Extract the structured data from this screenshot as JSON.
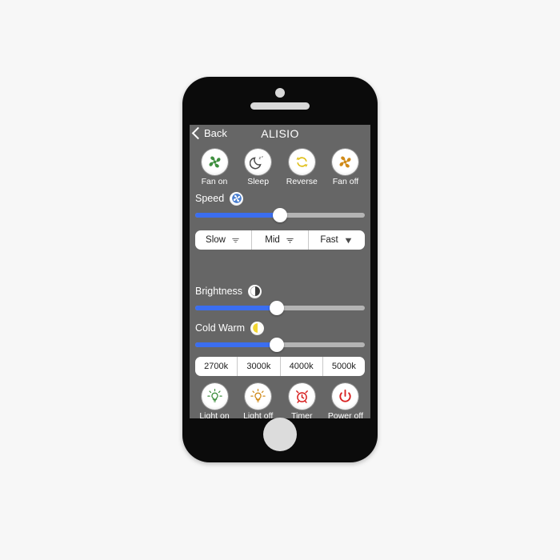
{
  "page": {
    "background_color": "#f7f7f7"
  },
  "phone": {
    "body_color": "#0b0b0b",
    "screen_background": "#666666",
    "home_button": "home-button",
    "earpiece": "earpiece-speaker",
    "camera": "front-camera"
  },
  "navbar": {
    "back_label": "Back",
    "title": "ALISIO"
  },
  "fan_controls": [
    {
      "label": "Fan on",
      "icon": "fan-icon",
      "color": "#3f8f3f"
    },
    {
      "label": "Sleep",
      "icon": "moon-zzz-icon",
      "color": "#4a4a4a"
    },
    {
      "label": "Reverse",
      "icon": "reverse-arrows-icon",
      "color": "#e0c01c"
    },
    {
      "label": "Fan off",
      "icon": "fan-icon",
      "color": "#d08a18"
    }
  ],
  "speed": {
    "label": "Speed",
    "badge_icon": "fan-badge-icon",
    "badge_color": "#4a7fd0",
    "value_percent": 50,
    "fill_color": "#3b6ef0",
    "track_color": "#b4b4b4"
  },
  "speed_presets": [
    {
      "label": "Slow",
      "icon": "signal-weak-icon"
    },
    {
      "label": "Mid",
      "icon": "signal-mid-icon"
    },
    {
      "label": "Fast",
      "icon": "signal-strong-icon"
    }
  ],
  "brightness": {
    "label": "Brightness",
    "badge_icon": "half-circle-icon",
    "badge_color": "#ffffff",
    "value_percent": 48,
    "fill_color": "#3b6ef0",
    "track_color": "#b4b4b4"
  },
  "cold_warm": {
    "label": "Cold Warm",
    "badge_icon": "half-circle-warm-icon",
    "badge_color": "#f2d632",
    "value_percent": 48,
    "fill_color": "#3b6ef0",
    "track_color": "#b4b4b4"
  },
  "color_temperature_presets": [
    {
      "label": "2700k"
    },
    {
      "label": "3000k"
    },
    {
      "label": "4000k"
    },
    {
      "label": "5000k"
    }
  ],
  "light_controls": [
    {
      "label": "Light on",
      "icon": "bulb-on-icon",
      "color": "#3f8f3f"
    },
    {
      "label": "Light off",
      "icon": "bulb-off-icon",
      "color": "#d08a18"
    },
    {
      "label": "Timer",
      "icon": "alarm-clock-icon",
      "color": "#d82020"
    },
    {
      "label": "Power off",
      "icon": "power-icon",
      "color": "#d82020"
    }
  ]
}
